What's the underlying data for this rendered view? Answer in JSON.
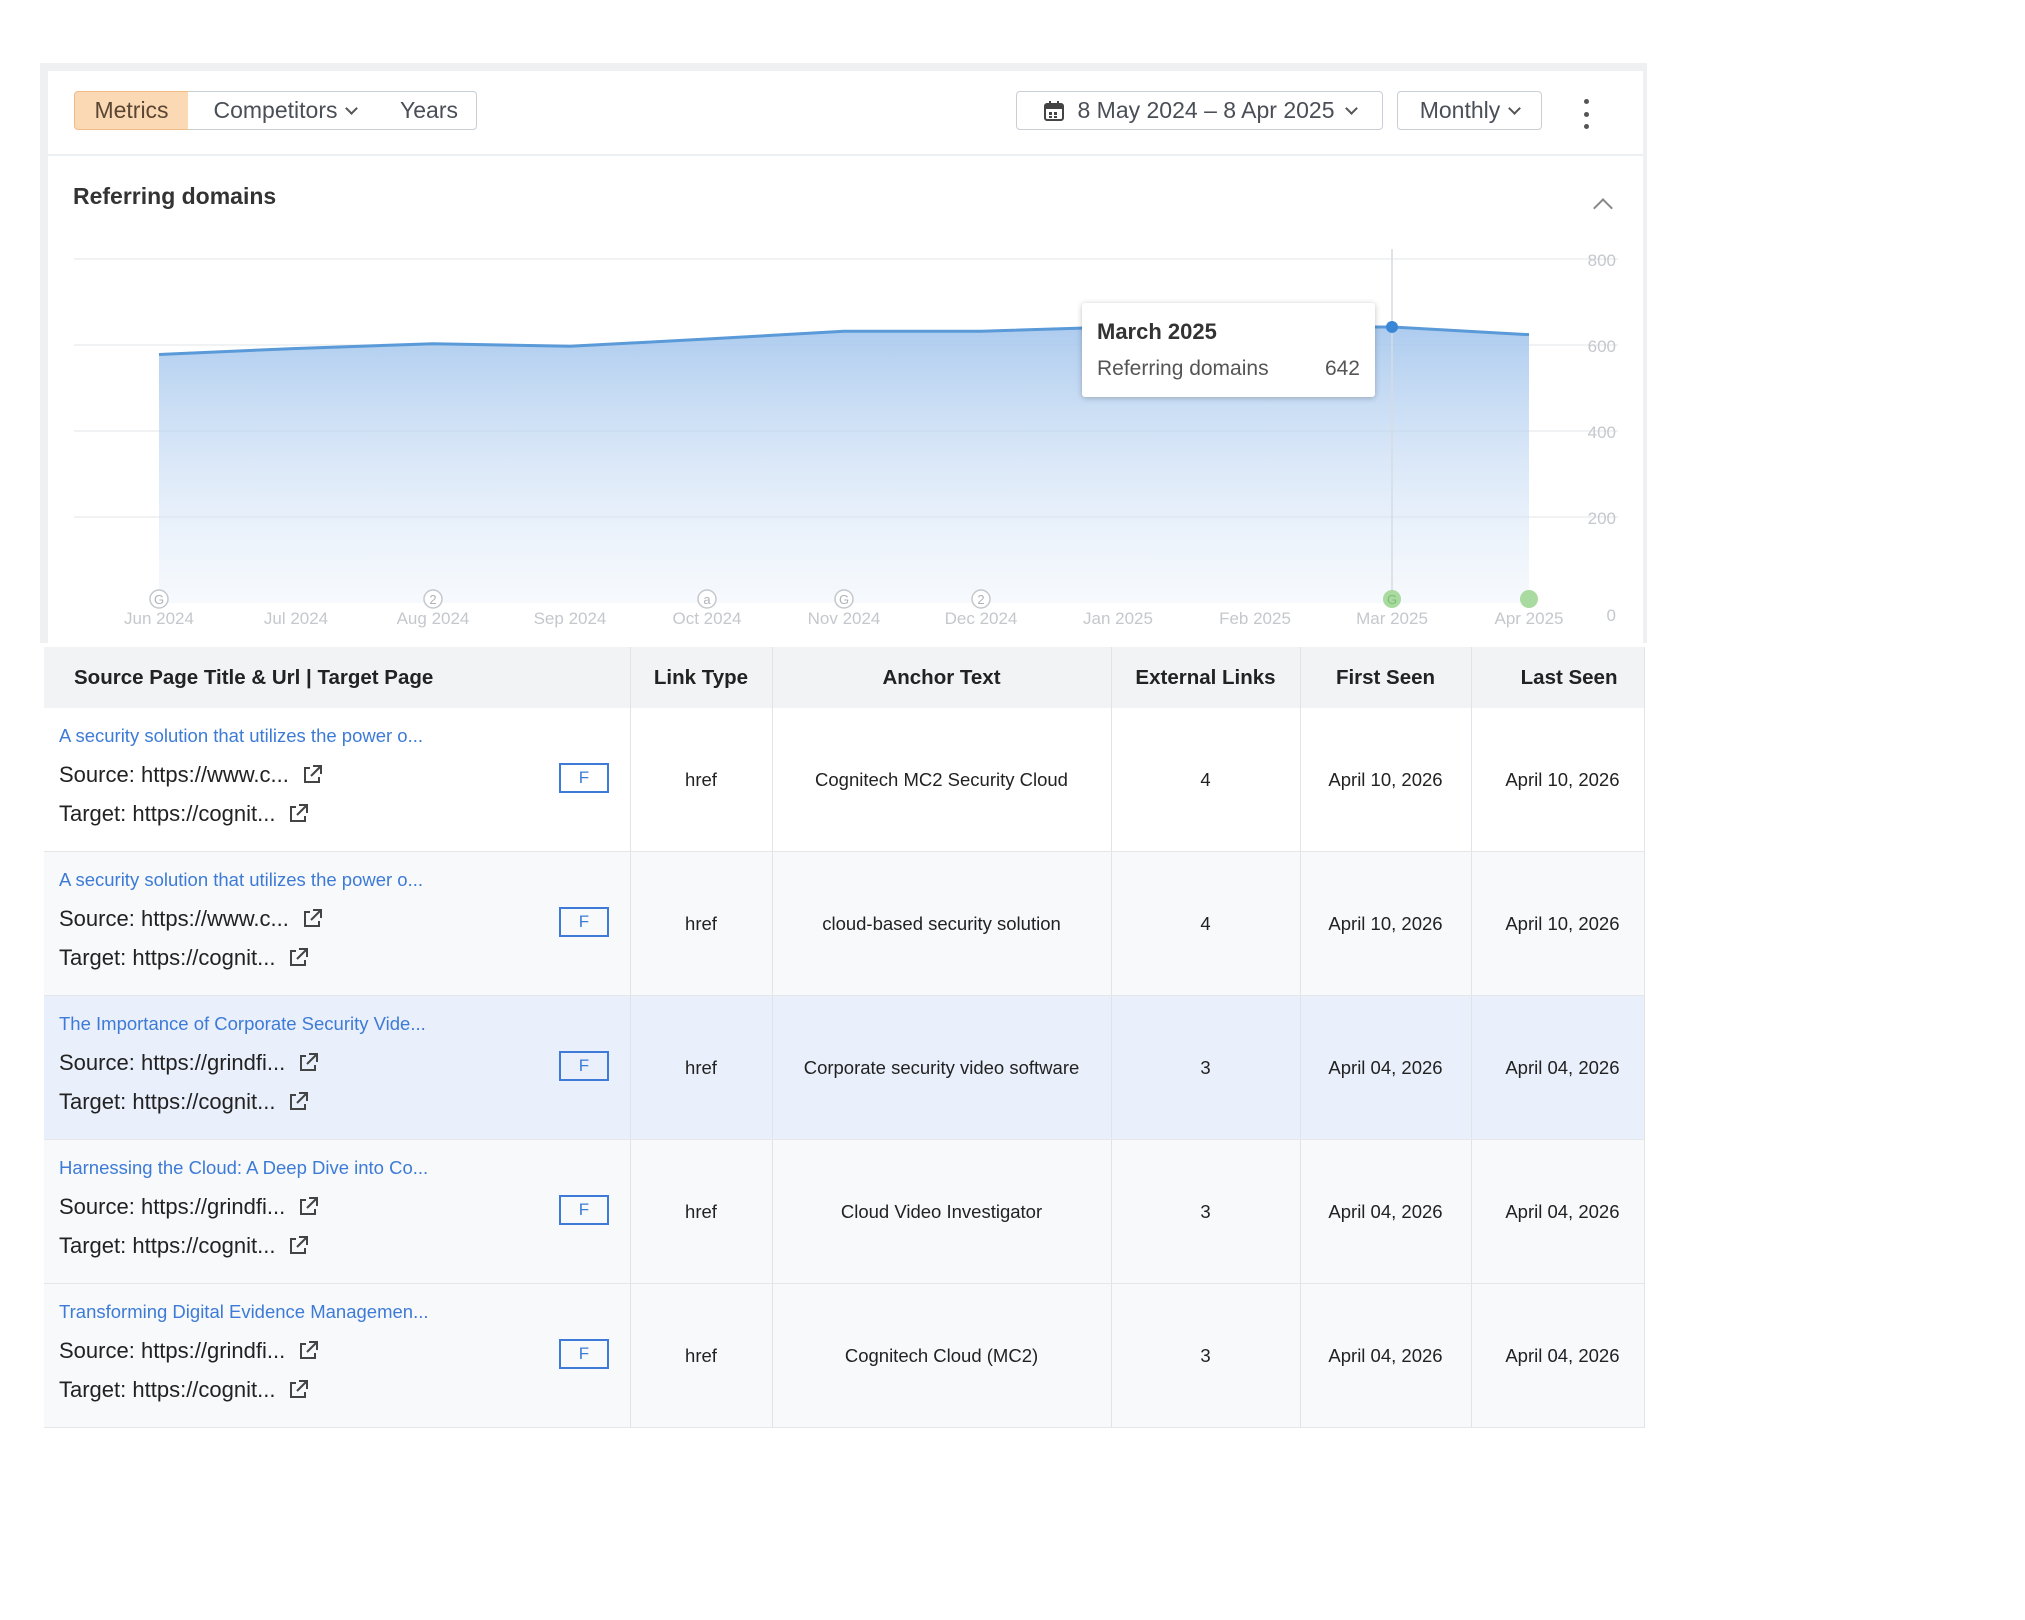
{
  "toolbar": {
    "tabs": [
      {
        "label": "Metrics",
        "active": true
      },
      {
        "label": "Competitors",
        "dropdown": true
      },
      {
        "label": "Years"
      }
    ],
    "date_range": "8 May 2024 – 8 Apr 2025",
    "granularity": "Monthly",
    "accent_color": "#fbd9b4"
  },
  "section": {
    "title": "Referring domains"
  },
  "chart_data": {
    "type": "area",
    "x": [
      "Jun 2024",
      "Jul 2024",
      "Aug 2024",
      "Sep 2024",
      "Oct 2024",
      "Nov 2024",
      "Dec 2024",
      "Jan 2025",
      "Feb 2025",
      "Mar 2025",
      "Apr 2025"
    ],
    "series": [
      {
        "name": "Referring domains",
        "color": "#5a9ad8",
        "values": [
          578,
          592,
          603,
          597,
          614,
          632,
          632,
          642,
          642,
          642,
          624
        ]
      }
    ],
    "ylim": [
      0,
      800
    ],
    "yticks": [
      "800",
      "600",
      "400",
      "200",
      "0"
    ],
    "grid": true,
    "markers": [
      {
        "x": "Jun 2024",
        "label": "G"
      },
      {
        "x": "Aug 2024",
        "label": "2"
      },
      {
        "x": "Oct 2024",
        "label": "a"
      },
      {
        "x": "Nov 2024",
        "label": "G"
      },
      {
        "x": "Dec 2024",
        "label": "2"
      },
      {
        "x": "Mar 2025",
        "label": "G",
        "color": "#a9dba0"
      },
      {
        "x": "Apr 2025",
        "label": "",
        "color": "#a9dba0"
      }
    ],
    "tooltip": {
      "x": "Mar 2025",
      "date": "March 2025",
      "series": "Referring domains",
      "value": "642"
    }
  },
  "table": {
    "columns": [
      "Source Page Title & Url | Target Page",
      "Link Type",
      "Anchor Text",
      "External Links",
      "First Seen",
      "Last Seen"
    ],
    "rows": [
      {
        "title": "A security solution that utilizes the power o...",
        "source": "https://www.c...",
        "target": "https://cognit...",
        "badge": "F",
        "link_type": "href",
        "anchor": "Cognitech MC2 Security Cloud",
        "external": "4",
        "first_seen": "April 10, 2026",
        "last_seen": "April 10, 2026"
      },
      {
        "title": "A security solution that utilizes the power o...",
        "source": "https://www.c...",
        "target": "https://cognit...",
        "badge": "F",
        "link_type": "href",
        "anchor": "cloud-based security solution",
        "external": "4",
        "first_seen": "April 10, 2026",
        "last_seen": "April 10, 2026"
      },
      {
        "title": "The Importance of Corporate Security Vide...",
        "source": "https://grindfi...",
        "target": "https://cognit...",
        "badge": "F",
        "link_type": "href",
        "anchor": "Corporate security video software",
        "external": "3",
        "first_seen": "April 04, 2026",
        "last_seen": "April 04, 2026",
        "highlight": true
      },
      {
        "title": "Harnessing the Cloud: A Deep Dive into Co...",
        "source": "https://grindfi...",
        "target": "https://cognit...",
        "badge": "F",
        "link_type": "href",
        "anchor": "Cloud Video Investigator",
        "external": "3",
        "first_seen": "April 04, 2026",
        "last_seen": "April 04, 2026"
      },
      {
        "title": "Transforming Digital Evidence Managemen...",
        "source": "https://grindfi...",
        "target": "https://cognit...",
        "badge": "F",
        "link_type": "href",
        "anchor": "Cognitech Cloud (MC2)",
        "external": "3",
        "first_seen": "April 04, 2026",
        "last_seen": "April 04, 2026"
      }
    ],
    "labels": {
      "source": "Source:",
      "target": "Target:"
    }
  }
}
